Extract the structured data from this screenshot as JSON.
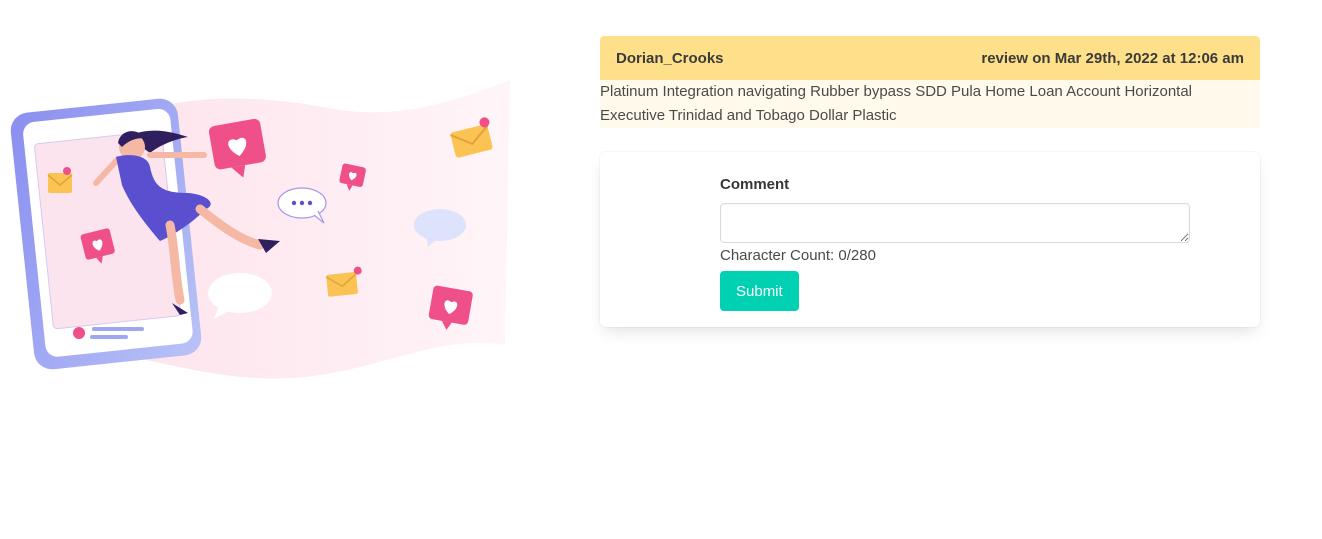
{
  "review": {
    "author": "Dorian_Crooks",
    "meta": "review on Mar 29th, 2022 at 12:06 am",
    "text": "Platinum Integration navigating Rubber bypass SDD Pula Home Loan Account Horizontal Executive Trinidad and Tobago Dollar Plastic"
  },
  "comment_form": {
    "label": "Comment",
    "value": "",
    "placeholder": "",
    "char_count_text": "Character Count: 0/280",
    "submit_label": "Submit"
  },
  "colors": {
    "header_bg": "#ffe08a",
    "body_bg": "#fffaeb",
    "submit_bg": "#00d1b2",
    "heart_pink": "#f0508a",
    "envelope_yellow": "#fbc254",
    "dress_purple": "#5a4fcf"
  },
  "illustration": {
    "icons": [
      "phone-icon",
      "woman-figure",
      "heart-bubble-icon",
      "envelope-icon",
      "speech-bubble-icon"
    ]
  }
}
